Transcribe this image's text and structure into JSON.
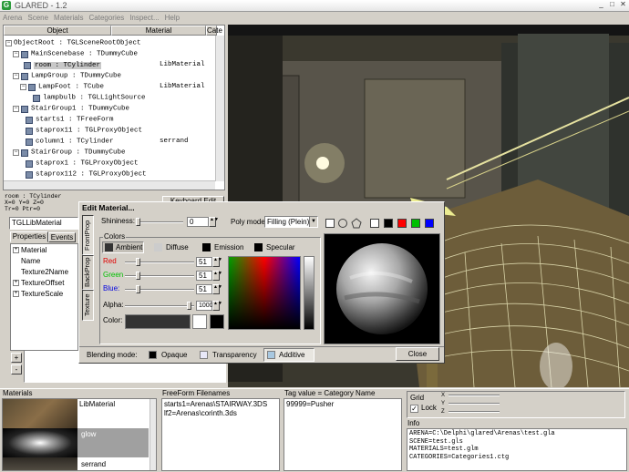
{
  "window": {
    "title": "GLARED - 1.2",
    "icon": "app-logo-icon"
  },
  "menu": [
    "Arena",
    "Scene",
    "Materials",
    "Categories",
    "Inspect...",
    "Help"
  ],
  "tree": {
    "col_object": "Object",
    "col_material": "Material",
    "col_category": "Cate",
    "rows": [
      {
        "label": "ObjectRoot : TGLSceneRootObject",
        "material": ""
      },
      {
        "label": "MainScenebase : TDummyCube",
        "material": ""
      },
      {
        "label": "room : TCylinder",
        "material": "LibMaterial"
      },
      {
        "label": "LampGroup : TDummyCube",
        "material": ""
      },
      {
        "label": "LampFoot : TCube",
        "material": "LibMaterial"
      },
      {
        "label": "lampbulb : TGLLightSource",
        "material": ""
      },
      {
        "label": "StairGroup1 : TDummyCube",
        "material": ""
      },
      {
        "label": "starts1 : TFreeForm",
        "material": ""
      },
      {
        "label": "staprox11 : TGLProxyObject",
        "material": ""
      },
      {
        "label": "column1 : TCylinder",
        "material": "serrand"
      },
      {
        "label": "StairGroup : TDummyCube",
        "material": ""
      },
      {
        "label": "staprox1 : TGLProxyObject",
        "material": ""
      },
      {
        "label": "staprox112 : TGLProxyObject",
        "material": ""
      }
    ]
  },
  "status": {
    "line1": "room : TCylinder",
    "line2": "X=0 Y=0 Z=0",
    "line3": "Tr=0 Ptr=0",
    "button": "Keyboard Edit"
  },
  "props": {
    "header": "TGLLibMaterial",
    "tabs": [
      "Properties",
      "Events"
    ],
    "rows": [
      {
        "name": "Material",
        "value": ""
      },
      {
        "name": "Name",
        "value": ""
      },
      {
        "name": "Texture2Name",
        "value": ""
      },
      {
        "name": "TextureOffset",
        "value": ""
      },
      {
        "name": "TextureScale",
        "value": ""
      }
    ],
    "add": "+",
    "remove": "-"
  },
  "editmat": {
    "title": "Edit Material...",
    "side_tabs": [
      "FrontProp",
      "BackProp",
      "Texture"
    ],
    "shininess_label": "Shininess:",
    "shininess_value": "0",
    "polymode_label": "Poly mode:",
    "polymode_value": "Filling",
    "polymode_extra": "(Plein)",
    "colors_label": "Colors",
    "color_tabs": [
      "Ambient",
      "Diffuse",
      "Emission",
      "Specular"
    ],
    "red_label": "Red",
    "red_value": "51",
    "green_label": "Green",
    "green_value": "51",
    "blue_label": "Blue:",
    "blue_value": "51",
    "alpha_label": "Alpha:",
    "alpha_value": "1000",
    "color_label": "Color:",
    "blend_label": "Blending mode:",
    "blend_options": [
      "Opaque",
      "Transparency",
      "Additive"
    ],
    "close_label": "Close",
    "swatch_colors": [
      "#ffffff",
      "#000000",
      "#ff0000",
      "#00c000",
      "#0000ff"
    ]
  },
  "bottom": {
    "materials_label": "Materials",
    "materials": [
      "LibMaterial",
      "glow",
      "serrand"
    ],
    "freeform_label": "FreeForm Filenames",
    "freeform": [
      "starts1=Arenas\\STAIRWAY.3DS",
      "lf2=Arenas\\corinth.3ds"
    ],
    "tag_label": "Tag value = Category Name",
    "tags": [
      "99999=Pusher"
    ],
    "grid_label": "Grid",
    "lock_label": "Lock",
    "axes": [
      "X",
      "Y",
      "Z"
    ],
    "info_label": "Info",
    "info": [
      "ARENA=C:\\Delphi\\glared\\Arenas\\test.gla",
      "SCENE=test.gls",
      "MATERIALS=test.glm",
      "CATEGORIES=Categories1.ctg"
    ]
  }
}
